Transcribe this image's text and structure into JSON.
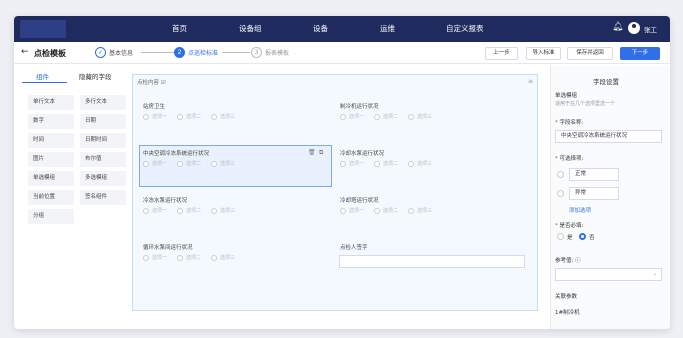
{
  "nav": {
    "items": [
      "首页",
      "设备组",
      "设备",
      "运维",
      "自定义报表"
    ],
    "user": "张工"
  },
  "page": {
    "title": "点检模板"
  },
  "steps": [
    {
      "num": "✓",
      "label": "基本信息"
    },
    {
      "num": "2",
      "label": "点巡检标准"
    },
    {
      "num": "3",
      "label": "报表模板"
    }
  ],
  "toolbar": {
    "prev": "上一步",
    "import": "导入标准",
    "save_return": "保存并返回",
    "next": "下一步"
  },
  "left": {
    "tabs": [
      "组件",
      "隐藏的字段"
    ],
    "components": [
      "单行文本",
      "多行文本",
      "数字",
      "日期",
      "时间",
      "日期时间",
      "图片",
      "布尔值",
      "单选模组",
      "多选模组",
      "当前位置",
      "签名组件",
      "分组"
    ]
  },
  "canvas": {
    "header": "点检内容 ☑",
    "options": [
      "选项一",
      "选项二",
      "选项三"
    ],
    "fields": [
      {
        "label": "站房卫生"
      },
      {
        "label": "制冷机运行状况"
      },
      {
        "label": "中央空调冷冻系统运行状况"
      },
      {
        "label": "冷却水泵运行状况"
      },
      {
        "label": "冷冻水泵运行状况"
      },
      {
        "label": "冷却塔运行状况"
      },
      {
        "label": "循环水泵间运行状况"
      },
      {
        "label": "点检人签字"
      }
    ]
  },
  "right": {
    "title": "字段设置",
    "type_label": "单选模组",
    "type_desc": "适用于在几个选项里选一个",
    "name_label": "字段名称:",
    "name_value": "中央空调冷冻系统运行状况",
    "options_label": "可选择项:",
    "options": [
      "正常",
      "异常"
    ],
    "add_option": "添加选项",
    "required_label": "是否必填:",
    "yes": "是",
    "no": "否",
    "ref_label": "参考值:",
    "related_label": "关联参数",
    "related_value": "1#制冷机"
  }
}
